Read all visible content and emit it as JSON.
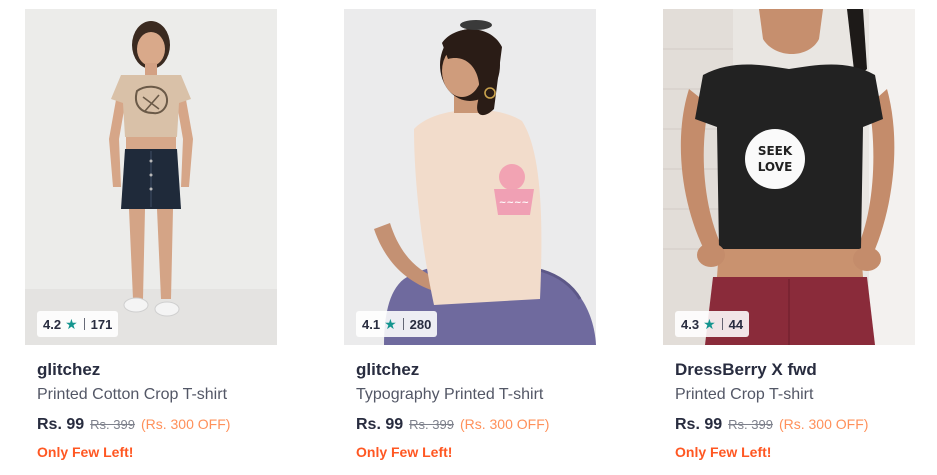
{
  "products": [
    {
      "brand": "glitchez",
      "name": "Printed Cotton Crop T-shirt",
      "rating": "4.2",
      "rating_count": "171",
      "price": "Rs. 99",
      "mrp": "Rs. 399",
      "discount": "(Rs. 300 OFF)",
      "stock": "Only Few Left!",
      "image_icon": "model-beige-crop-tee-denim-skirt"
    },
    {
      "brand": "glitchez",
      "name": "Typography Printed T-shirt",
      "rating": "4.1",
      "rating_count": "280",
      "price": "Rs. 99",
      "mrp": "Rs. 399",
      "discount": "(Rs. 300 OFF)",
      "stock": "Only Few Left!",
      "image_icon": "model-cream-tee-back-print"
    },
    {
      "brand": "DressBerry X fwd",
      "name": "Printed Crop T-shirt",
      "rating": "4.3",
      "rating_count": "44",
      "price": "Rs. 99",
      "mrp": "Rs. 399",
      "discount": "(Rs. 300 OFF)",
      "stock": "Only Few Left!",
      "image_icon": "model-black-crop-tee-seek-love-print",
      "print_text": [
        "SEEK",
        "LOVE"
      ]
    }
  ],
  "colors": {
    "rating_star": "#14958f",
    "text_primary": "#282c3f",
    "discount": "#ff905a",
    "stock_alert": "#ff5722"
  }
}
